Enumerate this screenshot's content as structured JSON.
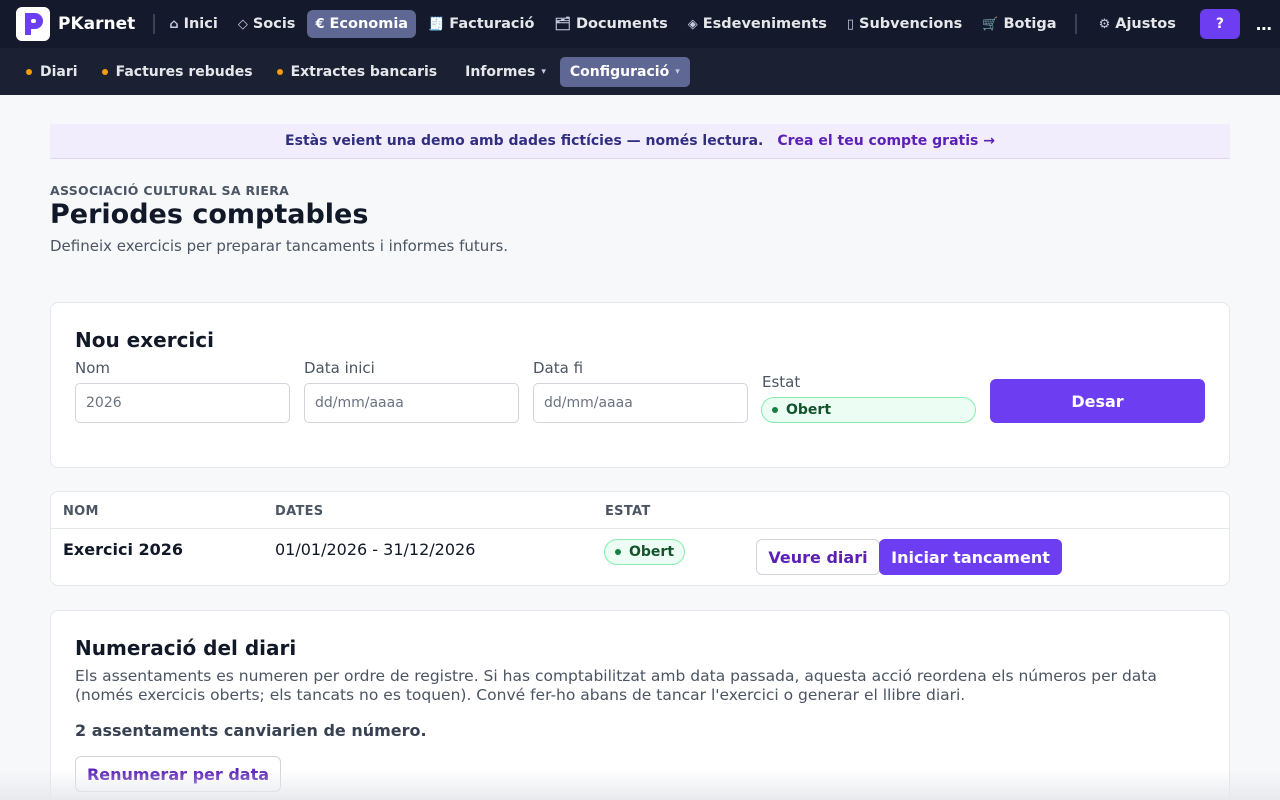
{
  "app": {
    "name": "PKarnet",
    "logo_letter": "P"
  },
  "nav": {
    "items": [
      {
        "label": "Inici",
        "icon": "⌂"
      },
      {
        "label": "Socis",
        "icon": "◇"
      },
      {
        "label": "Economia",
        "icon": "€"
      },
      {
        "label": "Facturació",
        "icon": "🧾"
      },
      {
        "label": "Documents",
        "icon": "🗂"
      },
      {
        "label": "Esdeveniments",
        "icon": "◈"
      },
      {
        "label": "Subvencions",
        "icon": "▯"
      },
      {
        "label": "Botiga",
        "icon": "🛒"
      }
    ],
    "ajustos": {
      "label": "Ajustos",
      "icon": "⚙"
    },
    "help_label": "?",
    "more_label": "…"
  },
  "subnav": {
    "items": [
      {
        "label": "Diari"
      },
      {
        "label": "Factures rebudes"
      },
      {
        "label": "Extractes bancaris"
      },
      {
        "label": "Informes",
        "caret": "▾"
      },
      {
        "label": "Configuració",
        "caret": "▾"
      }
    ]
  },
  "banner": {
    "text": "Estàs veient una demo amb dades fictícies — només lectura.",
    "link": "Crea el teu compte gratis →"
  },
  "page": {
    "org": "ASSOCIACIÓ CULTURAL SA RIERA",
    "title": "Periodes comptables",
    "subtitle": "Defineix exercicis per preparar tancaments i informes futurs."
  },
  "new_exercise": {
    "title": "Nou exercici",
    "name_label": "Nom",
    "name_value": "2026",
    "start_label": "Data inici",
    "start_placeholder": "dd/mm/aaaa",
    "end_label": "Data fi",
    "end_placeholder": "dd/mm/aaaa",
    "status_label": "Estat",
    "status_value": "Obert",
    "save_label": "Desar"
  },
  "periods_table": {
    "headers": {
      "name": "NOM",
      "dates": "DATES",
      "status": "ESTAT"
    },
    "rows": [
      {
        "name": "Exercici 2026",
        "dates": "01/01/2026 - 31/12/2026",
        "status": "Obert",
        "view_label": "Veure diari",
        "close_label": "Iniciar tancament"
      }
    ]
  },
  "numbering": {
    "title": "Numeració del diari",
    "description": "Els assentaments es numeren per ordre de registre. Si has comptabilitzat amb data passada, aquesta acció reordena els números per data (només exercicis oberts; els tancats no es toquen). Convé fer-ho abans de tancar l'exercici o generar el llibre diari.",
    "count_text": "2 assentaments canviarien de número.",
    "button_label": "Renumerar per data"
  },
  "colors": {
    "nav_bg": "#141a2b",
    "subnav_bg": "#1b2133",
    "accent": "#6d3df2",
    "active_nav": "#5f6894",
    "status_green": "#15803d"
  }
}
